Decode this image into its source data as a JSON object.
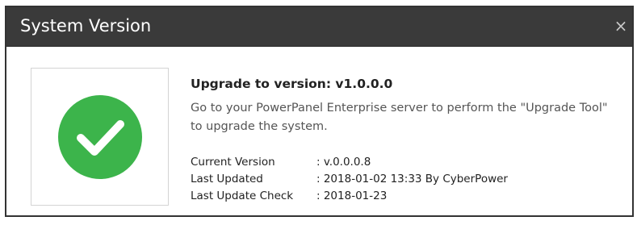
{
  "dialog": {
    "title": "System Version",
    "close_glyph": "×",
    "icon": "check-circle-icon",
    "accent_color": "#3cb44b",
    "heading": "Upgrade to version: v1.0.0.0",
    "message": "Go to your PowerPanel Enterprise server to perform the \"Upgrade Tool\" to upgrade the system.",
    "details": [
      {
        "label": "Current Version",
        "value": ": v.0.0.0.8"
      },
      {
        "label": "Last Updated",
        "value": ": 2018-01-02 13:33 By CyberPower"
      },
      {
        "label": "Last Update Check",
        "value": ": 2018-01-23"
      }
    ]
  }
}
